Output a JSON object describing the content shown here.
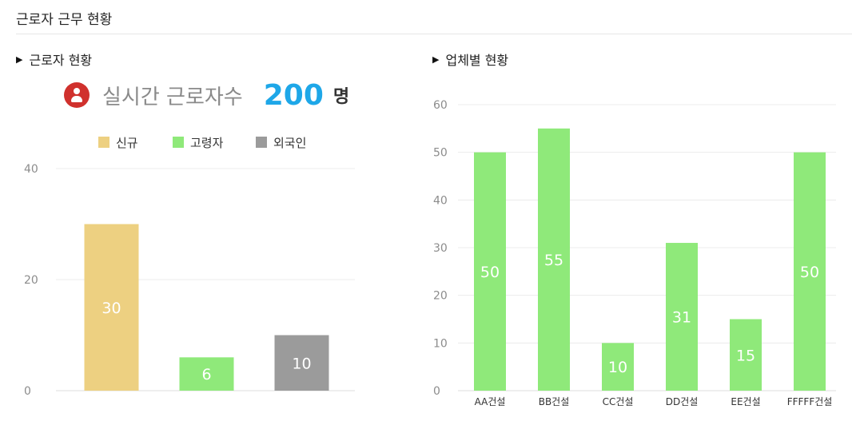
{
  "page": {
    "title": "근로자 근무 현황"
  },
  "left_panel": {
    "header": "근로자 현황",
    "summary": {
      "label": "실시간 근로자수",
      "value": "200",
      "unit": "명",
      "icon": "user-icon",
      "icon_color": "#d0312d",
      "value_color": "#1ea7e8"
    }
  },
  "right_panel": {
    "header": "업체별 현황"
  },
  "chart_data": [
    {
      "type": "bar",
      "categories": [
        "신규",
        "고령자",
        "외국인"
      ],
      "values": [
        30,
        6,
        10
      ],
      "colors": [
        "#edd081",
        "#8fe97a",
        "#9b9b9b"
      ],
      "legend": {
        "entries": [
          "신규",
          "고령자",
          "외국인"
        ],
        "position": "top"
      },
      "ylim": [
        0,
        40
      ],
      "yticks": [
        0,
        20,
        40
      ],
      "data_labels": [
        "30",
        "6",
        "10"
      ],
      "grid": true
    },
    {
      "type": "bar",
      "categories": [
        "AA건설",
        "BB건설",
        "CC건설",
        "DD건설",
        "EE건설",
        "FFFFF건설"
      ],
      "values": [
        50,
        55,
        10,
        31,
        15,
        50
      ],
      "color": "#8fe97a",
      "ylim": [
        0,
        60
      ],
      "yticks": [
        0,
        10,
        20,
        30,
        40,
        50,
        60
      ],
      "data_labels": [
        "50",
        "55",
        "10",
        "31",
        "15",
        "50"
      ],
      "grid": true
    }
  ]
}
